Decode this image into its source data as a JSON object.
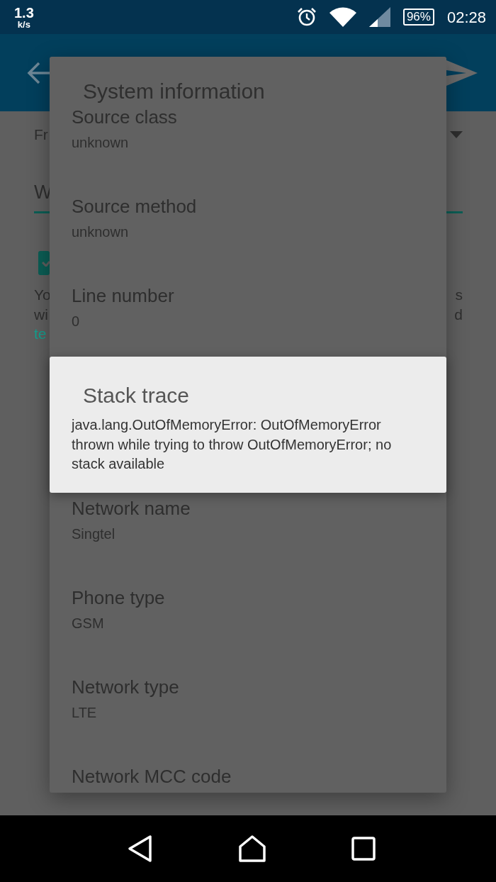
{
  "status_bar": {
    "net_speed": "1.3",
    "net_unit": "k/s",
    "battery": "96%",
    "time": "02:28"
  },
  "background": {
    "dropdown_text": "Fr",
    "input_text": "W",
    "checkbox": {
      "checked": true
    },
    "lines": [
      {
        "left": "Yo",
        "right": "s",
        "kind": "plain"
      },
      {
        "left": "wi",
        "right": "d",
        "kind": "plain"
      },
      {
        "left": "te",
        "kind": "link"
      }
    ]
  },
  "dialog": {
    "title": "System information",
    "items": [
      {
        "label": "Source class",
        "value": "unknown"
      },
      {
        "label": "Source method",
        "value": "unknown"
      },
      {
        "label": "Line number",
        "value": "0"
      },
      {
        "label": "Network name",
        "value": "Singtel"
      },
      {
        "label": "Phone type",
        "value": "GSM"
      },
      {
        "label": "Network type",
        "value": "LTE"
      },
      {
        "label": "Network MCC code"
      }
    ]
  },
  "alert": {
    "title": "Stack trace",
    "message": "java.lang.OutOfMemoryError: OutOfMemoryError thrown while trying to throw OutOfMemoryError; no stack available"
  }
}
